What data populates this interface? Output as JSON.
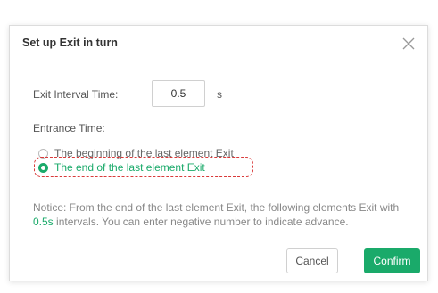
{
  "dialog": {
    "title": "Set up Exit in turn",
    "close_icon": "close-icon"
  },
  "interval": {
    "label": "Exit Interval Time:",
    "value": "0.5",
    "unit": "s"
  },
  "entrance": {
    "label": "Entrance Time:",
    "options": [
      {
        "label": "The beginning of the last element Exit",
        "selected": false
      },
      {
        "label": "The end of the last element Exit",
        "selected": true
      }
    ]
  },
  "notice": {
    "prefix": "Notice: From the end of the last element Exit, the following elements Exit with ",
    "value": "0.5s",
    "suffix": " intervals. You can enter negative number to indicate advance."
  },
  "buttons": {
    "cancel": "Cancel",
    "confirm": "Confirm"
  },
  "colors": {
    "accent": "#1aaa6a",
    "highlight": "#d93a3a"
  }
}
